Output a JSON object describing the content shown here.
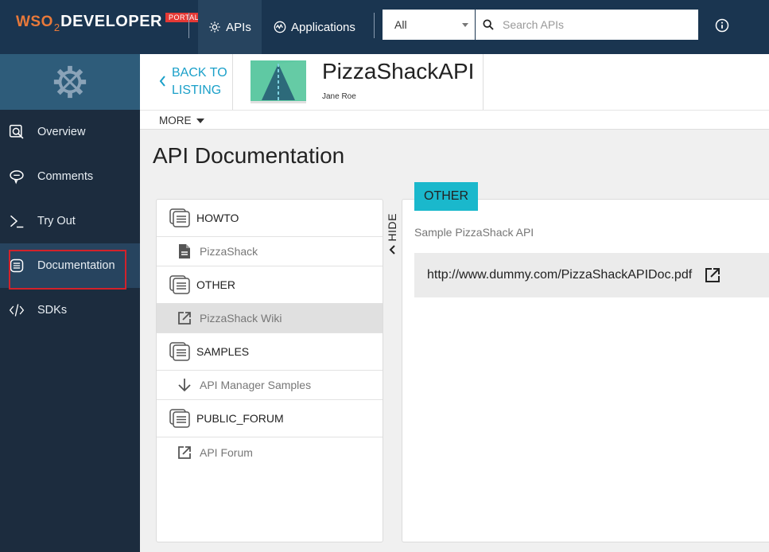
{
  "brand": {
    "logo_wso": "WSO",
    "logo_two": "2",
    "logo_developer": "DEVELOPER",
    "logo_portal": "PORTAL",
    "accent": "#e8793a",
    "badge_color": "#e53935"
  },
  "topnav": {
    "apis_label": "APIs",
    "applications_label": "Applications",
    "filter_value": "All",
    "search_placeholder": "Search APIs",
    "bg_color": "#1a3550"
  },
  "sidebar": {
    "items": [
      {
        "label": "Overview",
        "icon": "overview-search-icon"
      },
      {
        "label": "Comments",
        "icon": "comment-icon"
      },
      {
        "label": "Try Out",
        "icon": "terminal-icon"
      },
      {
        "label": "Documentation",
        "icon": "document-icon",
        "active": true
      },
      {
        "label": "SDKs",
        "icon": "code-icon"
      }
    ]
  },
  "header": {
    "back_line1": "BACK TO",
    "back_line2": "LISTING",
    "api_name": "PizzaShackAPI",
    "api_owner": "Jane Roe",
    "more_label": "MORE",
    "link_color": "#1ba0c9"
  },
  "page": {
    "title": "API Documentation"
  },
  "docs": {
    "hide_label": "HIDE",
    "categories": [
      {
        "name": "HOWTO",
        "doc": {
          "label": "PizzaShack",
          "icon": "file-icon"
        }
      },
      {
        "name": "OTHER",
        "doc": {
          "label": "PizzaShack Wiki",
          "icon": "external-link-icon",
          "selected": true
        }
      },
      {
        "name": "SAMPLES",
        "doc": {
          "label": "API Manager Samples",
          "icon": "download-arrow-icon"
        }
      },
      {
        "name": "PUBLIC_FORUM",
        "doc": {
          "label": "API Forum",
          "icon": "external-link-icon"
        }
      }
    ]
  },
  "detail": {
    "tag": "OTHER",
    "tag_color": "#1ab8cc",
    "summary": "Sample PizzaShack API",
    "url": "http://www.dummy.com/PizzaShackAPIDoc.pdf"
  }
}
